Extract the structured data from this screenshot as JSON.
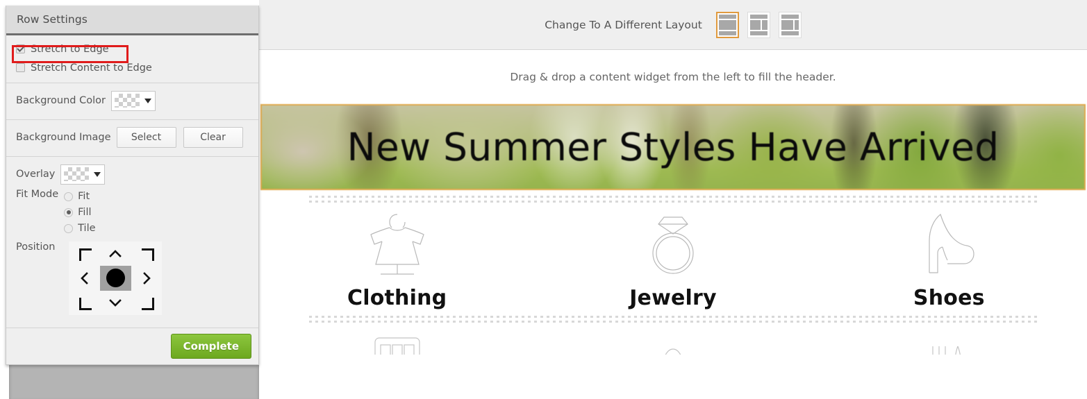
{
  "panel": {
    "title": "Row Settings",
    "stretch_to_edge": {
      "label": "Stretch to Edge",
      "checked": true
    },
    "stretch_content_to_edge": {
      "label": "Stretch Content to Edge",
      "checked": false
    },
    "background_color": {
      "label": "Background Color",
      "value": "transparent"
    },
    "background_image": {
      "label": "Background Image",
      "select_label": "Select",
      "clear_label": "Clear"
    },
    "overlay": {
      "label": "Overlay",
      "value": "transparent"
    },
    "fit_mode": {
      "label": "Fit Mode",
      "options": [
        "Fit",
        "Fill",
        "Tile"
      ],
      "selected": "Fill"
    },
    "position": {
      "label": "Position",
      "selected": "center"
    },
    "complete_button": "Complete",
    "highlight_color": "#e01b1b"
  },
  "toolbar": {
    "change_layout_label": "Change To A Different Layout",
    "layouts": [
      {
        "name": "full-width-layout",
        "active": true
      },
      {
        "name": "two-column-left-layout",
        "active": false
      },
      {
        "name": "two-column-right-layout",
        "active": false
      }
    ],
    "active_accent": "#e09a3e"
  },
  "editor": {
    "dropzone_text": "Drag & drop a content widget from the left to fill the header.",
    "hero": {
      "headline": "New Summer Styles Have Arrived",
      "border_color": "#e0a94c"
    },
    "categories": [
      {
        "label": "Clothing",
        "icon": "dress-icon"
      },
      {
        "label": "Jewelry",
        "icon": "ring-icon"
      },
      {
        "label": "Shoes",
        "icon": "high-heel-icon"
      }
    ],
    "categories_next_row": [
      {
        "icon": "wardrobe-icon"
      },
      {
        "icon": "hat-icon"
      },
      {
        "icon": "accessory-icon"
      }
    ]
  }
}
